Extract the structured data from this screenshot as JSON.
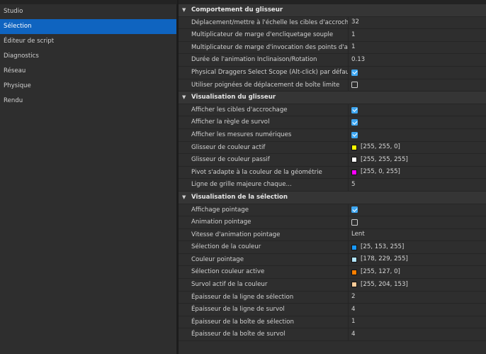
{
  "sidebar": {
    "items": [
      {
        "label": "Studio",
        "active": false
      },
      {
        "label": "Sélection",
        "active": true
      },
      {
        "label": "Éditeur de script",
        "active": false
      },
      {
        "label": "Diagnostics",
        "active": false
      },
      {
        "label": "Réseau",
        "active": false
      },
      {
        "label": "Physique",
        "active": false
      },
      {
        "label": "Rendu",
        "active": false
      }
    ]
  },
  "sections": [
    {
      "title": "Comportement du glisseur",
      "rows": [
        {
          "label": "Déplacement/mettre à l'échelle les cibles d'accrochage",
          "type": "text",
          "value": "32"
        },
        {
          "label": "Multiplicateur de marge d'encliquetage souple",
          "type": "text",
          "value": "1"
        },
        {
          "label": "Multiplicateur de marge d'invocation des points d'accrochage",
          "type": "text",
          "value": "1"
        },
        {
          "label": "Durée de l'animation Inclinaison/Rotation",
          "type": "text",
          "value": "0.13"
        },
        {
          "label": "Physical Draggers Select Scope (Alt-click) par défaut",
          "type": "check",
          "checked": true
        },
        {
          "label": "Utiliser poignées de déplacement de boîte limite",
          "type": "check",
          "checked": false
        }
      ]
    },
    {
      "title": "Visualisation du glisseur",
      "rows": [
        {
          "label": "Afficher les cibles d'accrochage",
          "type": "check",
          "checked": true
        },
        {
          "label": "Afficher la règle de survol",
          "type": "check",
          "checked": true
        },
        {
          "label": "Afficher les mesures numériques",
          "type": "check",
          "checked": true
        },
        {
          "label": "Glisseur de couleur actif",
          "type": "color",
          "value": "[255, 255, 0]",
          "color": "#ffff00"
        },
        {
          "label": "Glisseur de couleur passif",
          "type": "color",
          "value": "[255, 255, 255]",
          "color": "#ffffff"
        },
        {
          "label": "Pivot s'adapte à la couleur de la géométrie",
          "type": "color",
          "value": "[255, 0, 255]",
          "color": "#ff00ff"
        },
        {
          "label": "Ligne de grille majeure chaque...",
          "type": "text",
          "value": "5"
        }
      ]
    },
    {
      "title": "Visualisation de la sélection",
      "rows": [
        {
          "label": "Affichage pointage",
          "type": "check",
          "checked": true
        },
        {
          "label": "Animation pointage",
          "type": "check",
          "checked": false
        },
        {
          "label": "Vitesse d'animation pointage",
          "type": "text",
          "value": "Lent"
        },
        {
          "label": "Sélection de la couleur",
          "type": "color",
          "value": "[25, 153, 255]",
          "color": "#1999ff"
        },
        {
          "label": "Couleur pointage",
          "type": "color",
          "value": "[178, 229, 255]",
          "color": "#b2e5ff"
        },
        {
          "label": "Sélection couleur active",
          "type": "color",
          "value": "[255, 127, 0]",
          "color": "#ff7f00"
        },
        {
          "label": "Survol actif de la couleur",
          "type": "color",
          "value": "[255, 204, 153]",
          "color": "#ffcc99"
        },
        {
          "label": "Épaisseur de la ligne de sélection",
          "type": "text",
          "value": "2"
        },
        {
          "label": "Épaisseur de la ligne de survol",
          "type": "text",
          "value": "4"
        },
        {
          "label": "Épaisseur de la boîte de sélection",
          "type": "text",
          "value": "1"
        },
        {
          "label": "Épaisseur de la boîte de survol",
          "type": "text",
          "value": "4"
        }
      ]
    }
  ]
}
